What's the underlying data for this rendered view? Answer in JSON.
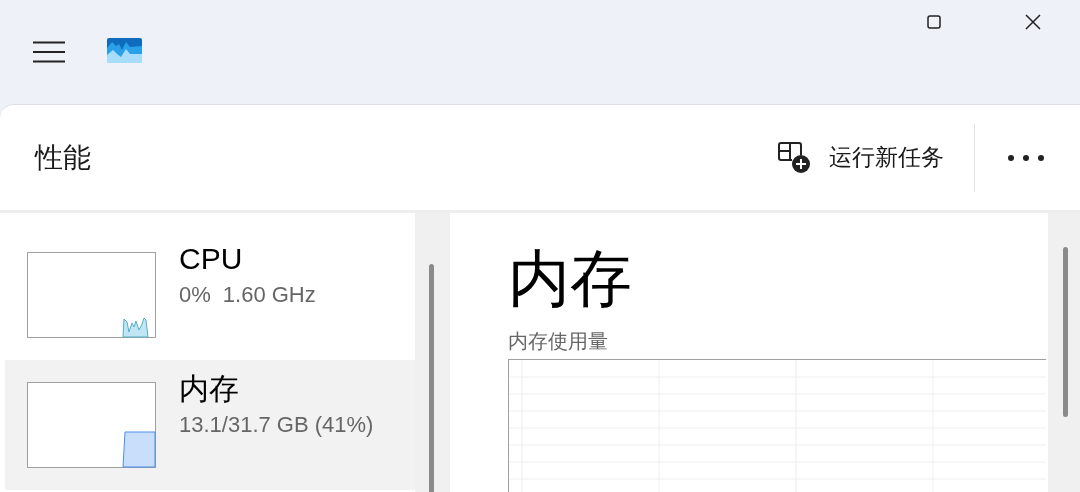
{
  "header": {
    "title": "性能",
    "run_task": "运行新任务"
  },
  "sidebar": {
    "items": [
      {
        "kind": "cpu",
        "name": "CPU",
        "details": [
          "0%",
          "1.60 GHz"
        ],
        "selected": false
      },
      {
        "kind": "memory",
        "name": "内存",
        "details": [
          "13.1/31.7 GB (41%)"
        ],
        "selected": true
      }
    ]
  },
  "main": {
    "title": "内存",
    "chart_label": "内存使用量"
  }
}
